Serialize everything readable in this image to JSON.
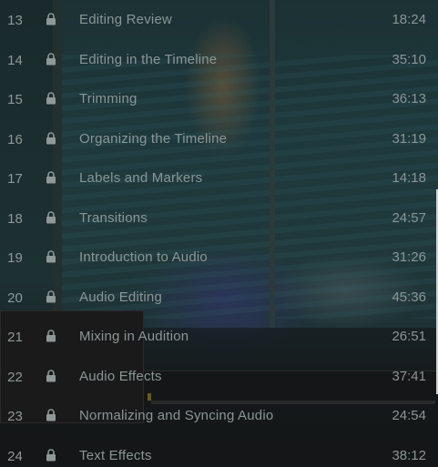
{
  "lessons": [
    {
      "number": "13",
      "title": "Editing Review",
      "duration": "18:24"
    },
    {
      "number": "14",
      "title": "Editing in the Timeline",
      "duration": "35:10"
    },
    {
      "number": "15",
      "title": "Trimming",
      "duration": "36:13"
    },
    {
      "number": "16",
      "title": "Organizing the Timeline",
      "duration": "31:19"
    },
    {
      "number": "17",
      "title": "Labels and Markers",
      "duration": "14:18"
    },
    {
      "number": "18",
      "title": "Transitions",
      "duration": "24:57"
    },
    {
      "number": "19",
      "title": "Introduction to Audio",
      "duration": "31:26"
    },
    {
      "number": "20",
      "title": "Audio Editing",
      "duration": "45:36"
    },
    {
      "number": "21",
      "title": "Mixing in Audition",
      "duration": "26:51"
    },
    {
      "number": "22",
      "title": "Audio Effects",
      "duration": "37:41"
    },
    {
      "number": "23",
      "title": "Normalizing and Syncing Audio",
      "duration": "24:54"
    },
    {
      "number": "24",
      "title": "Text Effects",
      "duration": "38:12"
    }
  ],
  "icons": {
    "lock": "lock-icon"
  },
  "colors": {
    "text": "#8b9595",
    "background": "#111314"
  }
}
